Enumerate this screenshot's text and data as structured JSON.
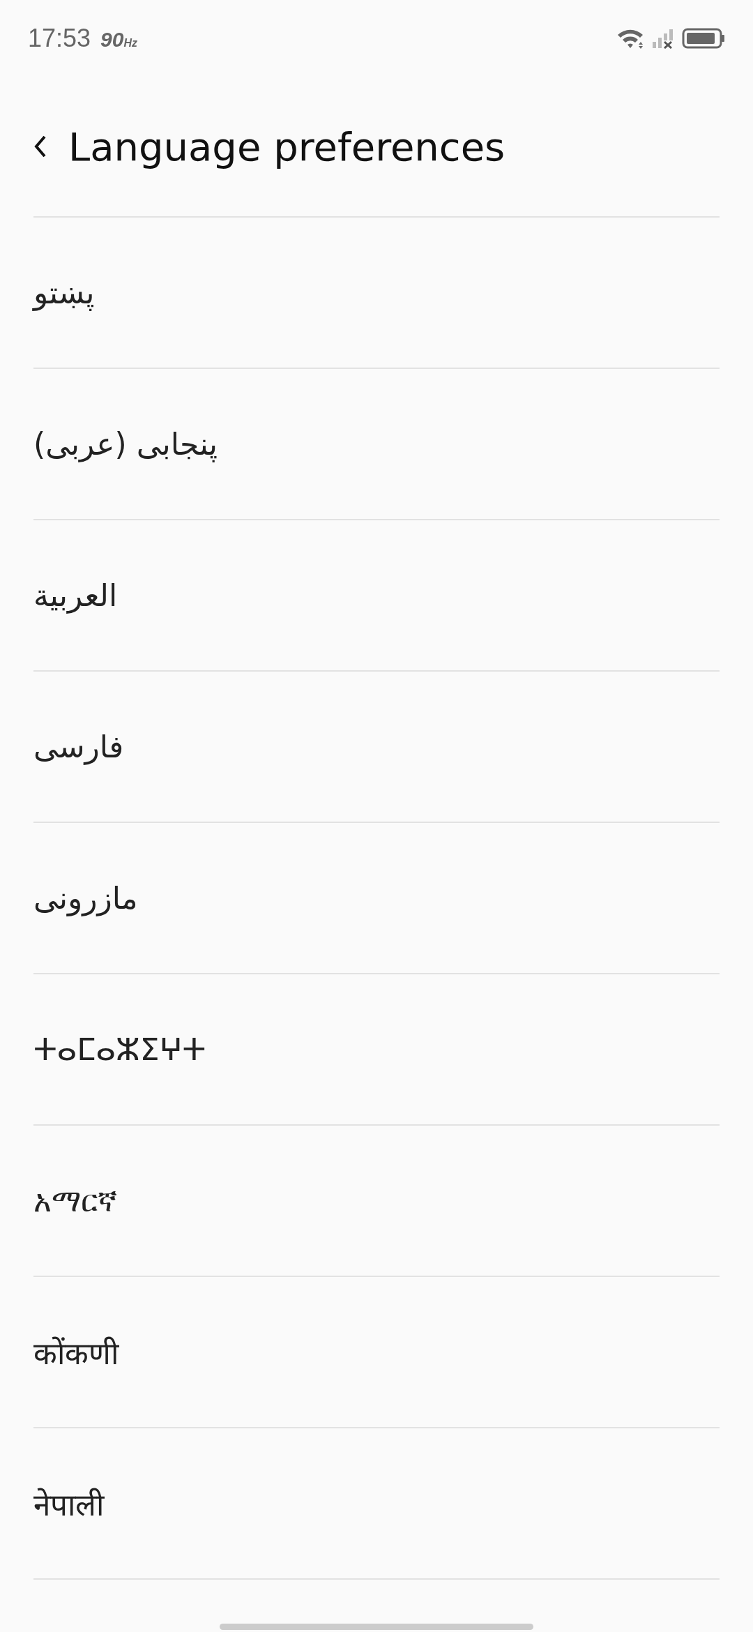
{
  "status_bar": {
    "time": "17:53",
    "refresh_rate": "90",
    "refresh_unit": "Hz"
  },
  "header": {
    "title": "Language preferences"
  },
  "languages": [
    {
      "label": "پښتو"
    },
    {
      "label": "پنجابی (عربی)"
    },
    {
      "label": "العربية"
    },
    {
      "label": "فارسی"
    },
    {
      "label": "مازرونی"
    },
    {
      "label": "ⵜⴰⵎⴰⵣⵉⵖⵜ"
    },
    {
      "label": "አማርኛ"
    },
    {
      "label": "कोंकणी"
    },
    {
      "label": "नेपाली"
    }
  ]
}
